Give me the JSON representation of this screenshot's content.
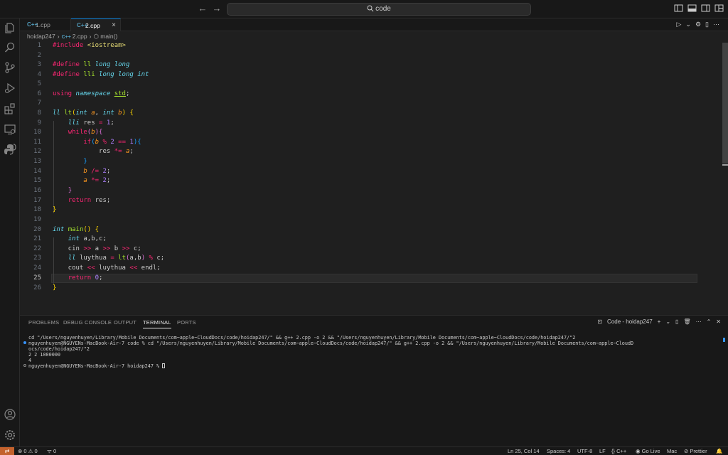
{
  "titlebar": {
    "search_text": "code"
  },
  "tabs": [
    {
      "label": "1.cpp",
      "icon": "C++"
    },
    {
      "label": "2.cpp",
      "icon": "C++",
      "close": "×"
    }
  ],
  "breadcrumb": {
    "folder": "hoidap247",
    "file": "2.cpp",
    "symbol": "main()",
    "file_icon": "C++"
  },
  "editor": {
    "line_numbers": [
      "1",
      "2",
      "3",
      "4",
      "5",
      "6",
      "7",
      "8",
      "9",
      "10",
      "11",
      "12",
      "13",
      "14",
      "15",
      "16",
      "17",
      "18",
      "19",
      "20",
      "21",
      "22",
      "23",
      "24",
      "25",
      "26"
    ],
    "current_line": "25"
  },
  "panel": {
    "tabs": [
      "PROBLEMS",
      "DEBUG CONSOLE",
      "OUTPUT",
      "TERMINAL",
      "PORTS"
    ],
    "terminal_name": "Code - hoidap247",
    "terminal_lines": [
      "cd \"/Users/nguyenhuyen/Library/Mobile Documents/com~apple~CloudDocs/code/hoidap247/\" && g++ 2.cpp -o 2 && \"/Users/nguyenhuyen/Library/Mobile Documents/com~apple~CloudDocs/code/hoidap247/\"2",
      "nguyenhuyen@NGUYENs-MacBook-Air-7 code % cd \"/Users/nguyenhuyen/Library/Mobile Documents/com~apple~CloudDocs/code/hoidap247/\" && g++ 2.cpp -o 2 && \"/Users/nguyenhuyen/Library/Mobile Documents/com~apple~CloudD",
      "ocs/code/hoidap247/\"2",
      "2 2 1000000",
      "4",
      "nguyenhuyen@NGUYENs-MacBook-Air-7 hoidap247 % "
    ]
  },
  "statusbar": {
    "errors": "0",
    "warnings": "0",
    "ports": "0",
    "position": "Ln 25, Col 14",
    "spaces": "Spaces: 4",
    "encoding": "UTF-8",
    "eol": "LF",
    "language": "C++",
    "go_live": "Go Live",
    "platform": "Mac",
    "prettier": "Prettier"
  },
  "colors": {
    "accent": "#0078d4",
    "remote": "#c4622d",
    "background": "#1f1f1f"
  }
}
